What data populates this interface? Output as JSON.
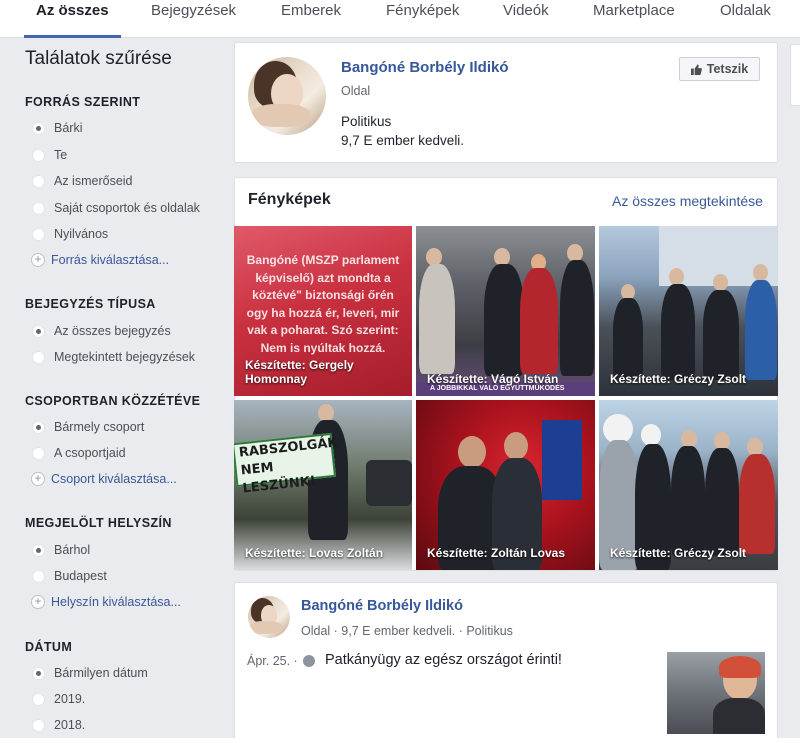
{
  "tabs": [
    "Az összes",
    "Bejegyzések",
    "Emberek",
    "Fényképek",
    "Videók",
    "Marketplace",
    "Oldalak"
  ],
  "sidebar": {
    "title": "Találatok szűrése",
    "sections": [
      {
        "heading": "FORRÁS SZERINT",
        "options": [
          "Bárki",
          "Te",
          "Az ismerőseid",
          "Saját csoportok és oldalak",
          "Nyilvános"
        ],
        "link": "Forrás kiválasztása..."
      },
      {
        "heading": "BEJEGYZÉS TÍPUSA",
        "options": [
          "Az összes bejegyzés",
          "Megtekintett bejegyzések"
        ]
      },
      {
        "heading": "CSOPORTBAN KÖZZÉTÉVE",
        "options": [
          "Bármely csoport",
          "A csoportjaid"
        ],
        "link": "Csoport kiválasztása..."
      },
      {
        "heading": "MEGJELÖLT HELYSZÍN",
        "options": [
          "Bárhol",
          "Budapest"
        ],
        "link": "Helyszín kiválasztása..."
      },
      {
        "heading": "DÁTUM",
        "options": [
          "Bármilyen dátum",
          "2019.",
          "2018."
        ]
      }
    ]
  },
  "page_card": {
    "name": "Bangóné Borbély Ildikó",
    "type": "Oldal",
    "category": "Politikus",
    "likes": "9,7 E ember kedveli.",
    "like_button": "Tetszik"
  },
  "photos": {
    "title": "Fényképek",
    "see_all": "Az összes megtekintése",
    "first_photo_text": [
      "Bangóné (MSZP parlament",
      "képviselő) azt mondta a",
      "köztévé\" biztonsági őrén",
      "ogy ha hozzá ér, leveri, mir",
      "vak a poharat. Szó szerint:",
      "Nem is nyúltak hozzá."
    ],
    "first_photo_sign": "A JOBBIKKAL VALÓ EGYÜTTMŰKÖDÉS",
    "banner_lines": [
      "RABSZOLGÁK",
      "NEM LESZÜNK!"
    ],
    "captions": [
      "Készítette: Gergely Homonnay",
      "Készítette: Vágó István",
      "Készítette: Gréczy Zsolt",
      "Készítette: Lovas Zoltán",
      "Készítette: Zoltán Lovas",
      "Készítette: Gréczy Zsolt"
    ]
  },
  "post": {
    "name": "Bangóné Borbély Ildikó",
    "meta": "Oldal · 9,7 E ember kedveli. · Politikus",
    "date": "Ápr. 25. ·",
    "text": "Patkányügy az egész országot érinti!"
  },
  "colors": {
    "link": "#385898",
    "name": "#365899",
    "accent": "#4267b2",
    "background": "#e9ebee"
  }
}
